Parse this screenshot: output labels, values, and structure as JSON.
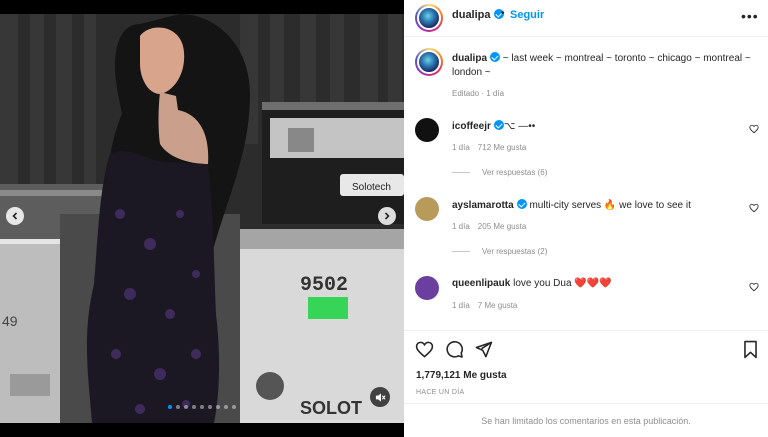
{
  "post": {
    "username": "dualipa",
    "separator": "•",
    "follow_label": "Seguir",
    "more_label": "•••",
    "caption_user": "dualipa",
    "caption_text": " ~ last week ~ montreal ~ toronto ~ chicago ~ montreal ~ london ~",
    "caption_meta": "Editado · 1 día",
    "likes": "1,779,121 Me gusta",
    "time_ago": "HACE UN DÍA",
    "comments_limited": "Se han limitado los comentarios en esta publicación.",
    "carousel": {
      "slides": 9,
      "active_index": 0
    }
  },
  "media": {
    "case_number": "9502",
    "brand_text": "Solotech",
    "brand_text_short": "SOLOT",
    "side_text": "49"
  },
  "comments": [
    {
      "user": "icoffeejr",
      "verified": true,
      "text": "⌥ —••",
      "age": "1 día",
      "likes": "712 Me gusta",
      "replies": "Ver respuestas (6)",
      "avatar_color": "#111111"
    },
    {
      "user": "ayslamarotta",
      "verified": true,
      "text": " multi-city serves 🔥 we love to see it",
      "age": "1 día",
      "likes": "205 Me gusta",
      "replies": "Ver respuestas (2)",
      "avatar_color": "#b89a5a"
    },
    {
      "user": "queenlipauk",
      "verified": false,
      "text": " love you Dua ❤️❤️❤️",
      "age": "1 día",
      "likes": "7 Me gusta",
      "replies": "",
      "avatar_color": "#6a3fa0"
    }
  ],
  "colors": {
    "accent": "#0095f6",
    "text": "#262626",
    "muted": "#8e8e8e"
  }
}
